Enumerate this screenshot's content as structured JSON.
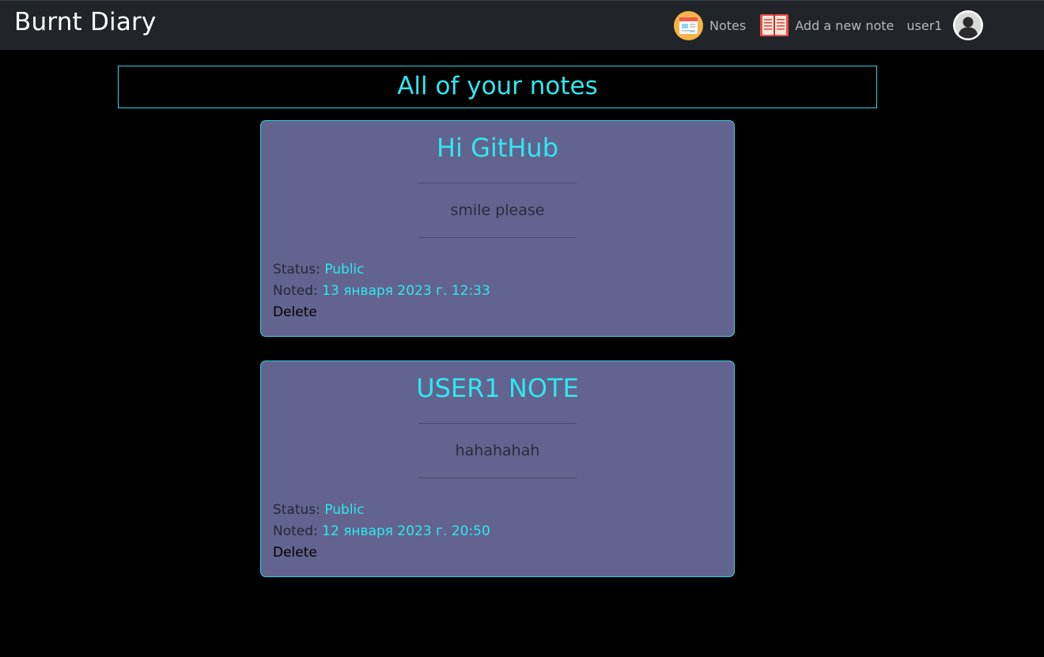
{
  "navbar": {
    "brand": "Burnt Diary",
    "notes_label": "Notes",
    "notes_icon": "newspaper-icon",
    "add_label": "Add a new note",
    "add_icon": "notebook-icon",
    "username": "user1",
    "avatar_icon": "user-avatar-icon"
  },
  "page": {
    "heading": "All of your notes"
  },
  "notes": [
    {
      "title": "Hi GitHub",
      "body": "smile please",
      "status_label": "Status:",
      "status_value": "Public",
      "noted_label": "Noted:",
      "noted_value": "13 января 2023 г. 12:33",
      "delete_label": "Delete"
    },
    {
      "title": "USER1 NOTE",
      "body": "hahahahah",
      "status_label": "Status:",
      "status_value": "Public",
      "noted_label": "Noted:",
      "noted_value": "12 января 2023 г. 20:50",
      "delete_label": "Delete"
    }
  ],
  "colors": {
    "navbar_bg": "#212529",
    "page_bg": "#000000",
    "accent_cyan": "#2ee8f0",
    "card_bg": "#63638f"
  }
}
